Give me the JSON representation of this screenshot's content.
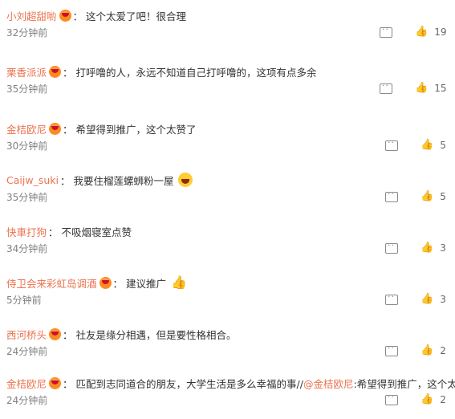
{
  "comments": [
    {
      "user": "小刘超甜喲",
      "text": "这个太爱了吧！很合理",
      "time": "32分钟前",
      "likes": "19",
      "emoji": ""
    },
    {
      "user": "栗香派派",
      "text": "打呼噜的人，永远不知道自己打呼噜的，这项有点多余",
      "time": "35分钟前",
      "likes": "15",
      "emoji": ""
    },
    {
      "user": "金桔欧尼",
      "text": "希望得到推广，这个太赞了",
      "time": "30分钟前",
      "likes": "5",
      "emoji": ""
    },
    {
      "user": "Caijw_suki",
      "text": "我要住榴莲螺蛳粉一屋",
      "time": "35分钟前",
      "likes": "5",
      "emoji": "laughing-emoji"
    },
    {
      "user": "快車打狗",
      "text": "不吸烟寝室点赞",
      "time": "34分钟前",
      "likes": "3",
      "emoji": ""
    },
    {
      "user": "侍卫会来彩虹岛调酒",
      "text": "建议推广",
      "time": "5分钟前",
      "likes": "3",
      "emoji": "thumbs-up-emoji"
    },
    {
      "user": "西河桥头",
      "text": "社友是缘分相遇，但是要性格相合。",
      "time": "24分钟前",
      "likes": "2",
      "emoji": ""
    },
    {
      "user": "金桔欧尼",
      "text": "匹配到志同道合的朋友，大学生活是多么幸福的事//",
      "mention": "@金桔欧尼",
      "text2": ":希望得到推广，这个太赞了",
      "time": "24分钟前",
      "likes": "2",
      "emoji": ""
    }
  ],
  "icons": {
    "badge": "vip-badge-icon",
    "reply": "reply-icon",
    "like": "like-icon"
  }
}
